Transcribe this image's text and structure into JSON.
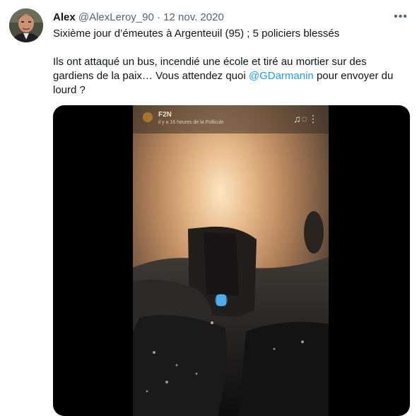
{
  "tweet": {
    "display_name": "Alex",
    "handle": "@AlexLeroy_90",
    "separator": "·",
    "date": "12 nov. 2020",
    "more_label": "•••",
    "text_line1": "Sixième jour d’émeutes à Argenteuil (95) ; 5 policiers blessés",
    "text_part1": "Ils ont attaqué un bus, incendié une école et tiré au mortier sur des gardiens de la paix… Vous attendez quoi ",
    "mention": "@GDarmanin",
    "text_part2": " pour envoyer du lourd ?"
  },
  "video": {
    "story_name": "F2N",
    "story_subtitle": "il y a 16 heures de la Pollicule",
    "story_icons": "♫◌⋮"
  },
  "colors": {
    "link": "#1d9bf0",
    "secondary_text": "#536471",
    "primary_text": "#0f1419"
  }
}
